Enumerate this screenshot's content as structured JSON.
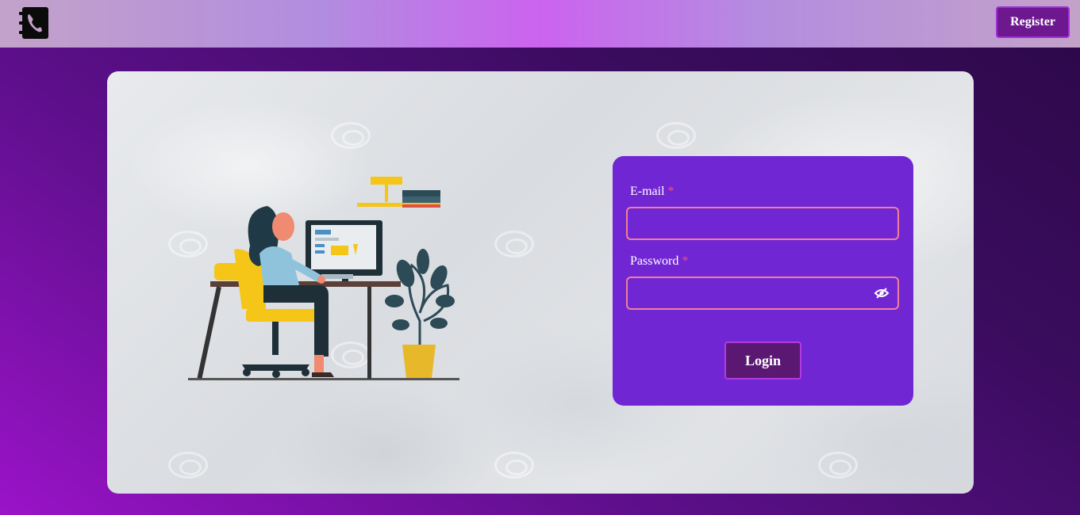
{
  "header": {
    "logo_icon": "phone-book-icon",
    "register_label": "Register"
  },
  "hero": {
    "illustration": "woman-at-desk-illustration"
  },
  "login_form": {
    "email_label": "E-mail",
    "password_label": "Password",
    "required_marker": "*",
    "email_value": "",
    "password_value": "",
    "password_toggle_icon": "eye-slash-icon",
    "login_label": "Login"
  },
  "colors": {
    "panel": "#7126d3",
    "input_border": "#f0809a",
    "button": "#5b1873",
    "required": "#ff4d6d"
  }
}
